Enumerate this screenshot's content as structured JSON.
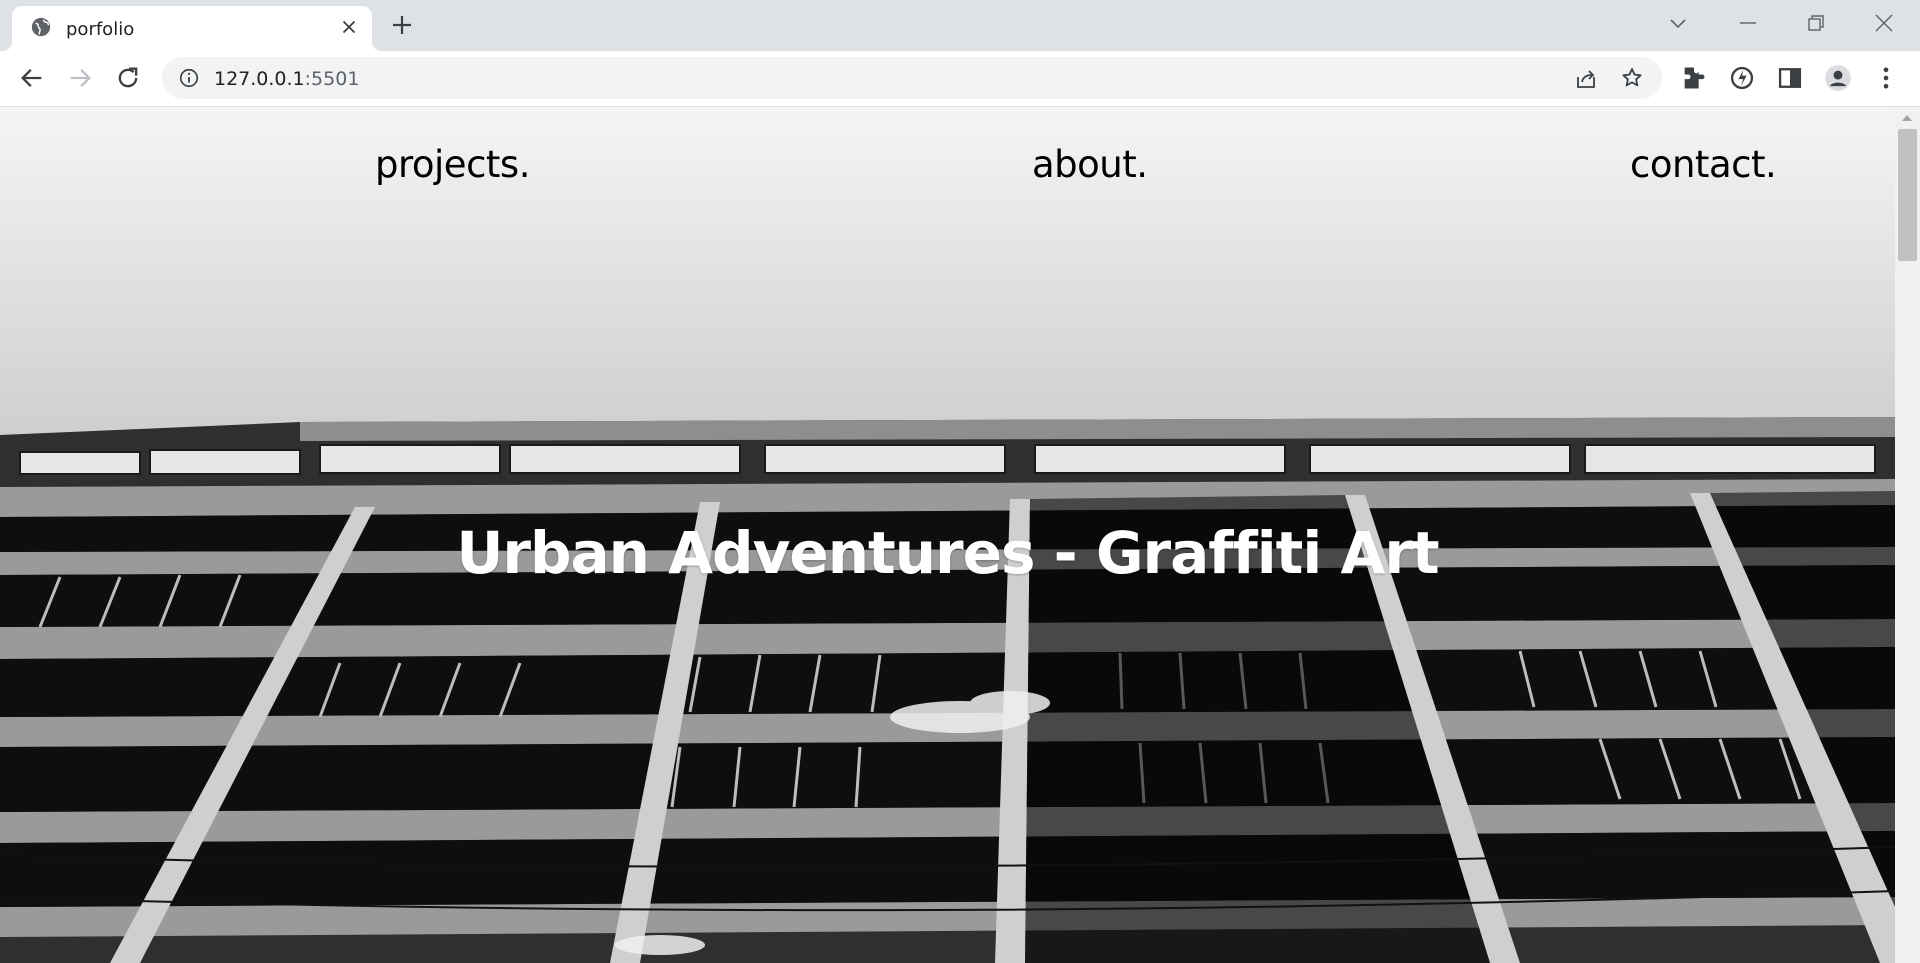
{
  "browser": {
    "tab": {
      "title": "porfolio",
      "favicon_icon": "globe-icon",
      "close_icon": "close-icon"
    },
    "new_tab_icon": "plus-icon",
    "window_controls": [
      "chevron-down-icon",
      "minimize-icon",
      "restore-icon",
      "close-icon"
    ],
    "nav_icons": [
      "back-arrow-icon",
      "forward-arrow-icon",
      "reload-icon"
    ],
    "address": {
      "host": "127.0.0.1",
      "port": ":5501",
      "info_icon": "info-icon"
    },
    "address_actions": [
      "share-icon",
      "star-icon"
    ],
    "toolbar_icons": [
      "extensions-icon",
      "performance-icon",
      "side-panel-icon",
      "profile-icon",
      "more-menu-icon"
    ]
  },
  "page": {
    "nav": {
      "projects": "projects.",
      "about": "about.",
      "contact": "contact."
    },
    "hero_title": "Urban Adventures - Graffiti Art",
    "hero_image": "black-and-white-building-facade"
  },
  "colors": {
    "tabstrip": "#dee1e6",
    "toolbar": "#ffffff",
    "omnibox": "#f1f3f4",
    "nav_text": "#000000",
    "hero_text": "#ffffff"
  }
}
